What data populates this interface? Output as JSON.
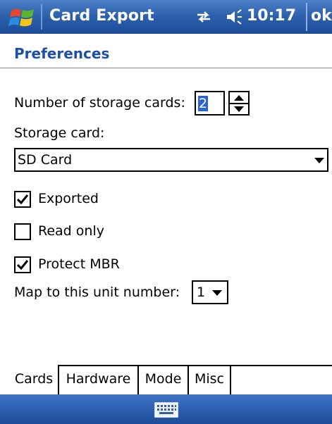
{
  "titlebar": {
    "app_title": "Card Export",
    "time": "10:17",
    "ok_label": "ok",
    "start_icon": "windows-flag-icon",
    "connectivity_icon": "connectivity-icon",
    "volume_icon": "volume-icon"
  },
  "page": {
    "title": "Preferences"
  },
  "form": {
    "num_cards_label": "Number of storage cards:",
    "num_cards_value": "2",
    "storage_card_label": "Storage card:",
    "storage_card_value": "SD Card",
    "exported_label": "Exported",
    "exported_checked": true,
    "read_only_label": "Read only",
    "read_only_checked": false,
    "protect_mbr_label": "Protect MBR",
    "protect_mbr_checked": true,
    "map_unit_label": "Map to this unit number:",
    "map_unit_value": "1"
  },
  "tabs": [
    {
      "label": "Cards",
      "active": true
    },
    {
      "label": "Hardware",
      "active": false
    },
    {
      "label": "Mode",
      "active": false
    },
    {
      "label": "Misc",
      "active": false
    }
  ],
  "bottombar": {
    "keyboard_icon": "keyboard-icon"
  },
  "colors": {
    "titlebar_blue": "#2e62ad",
    "header_text": "#1d4fa6",
    "selection_blue": "#2a64d4"
  }
}
